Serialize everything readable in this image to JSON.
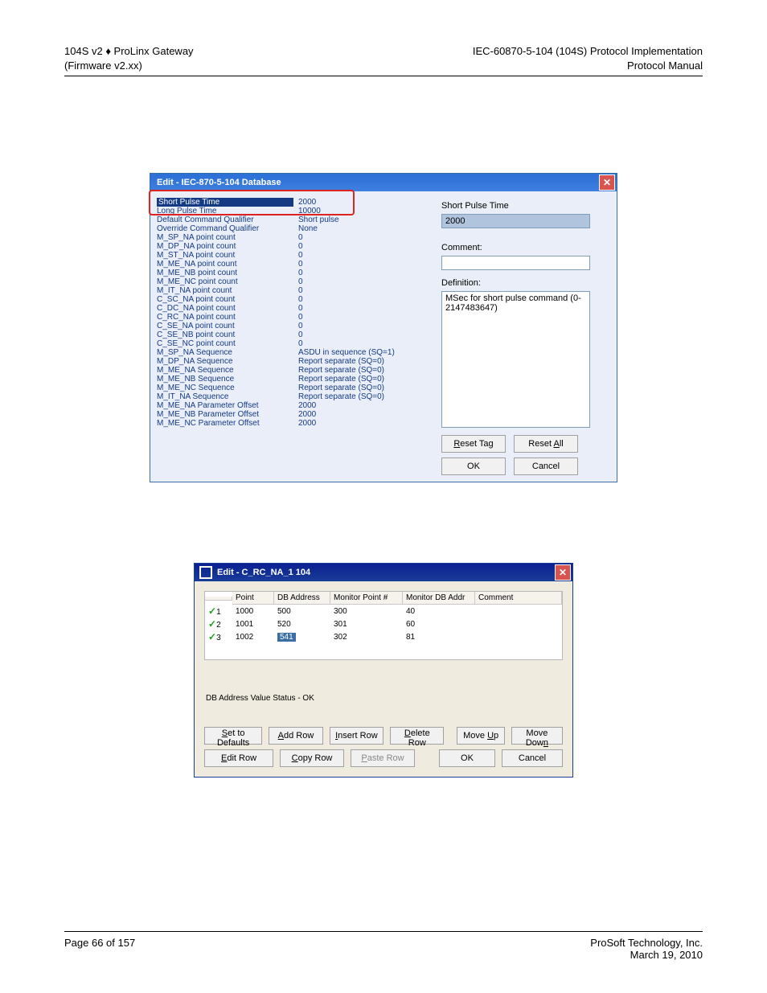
{
  "header": {
    "left1": "104S v2 ♦ ProLinx Gateway",
    "left2": "(Firmware v2.xx)",
    "right1": "IEC-60870-5-104 (104S) Protocol Implementation",
    "right2": "Protocol Manual"
  },
  "dialog1": {
    "title": "Edit - IEC-870-5-104 Database",
    "rows": [
      {
        "name": "Short Pulse Time",
        "val": "2000",
        "selected": true
      },
      {
        "name": "Long Pulse Time",
        "val": "10000"
      },
      {
        "name": "Default Command Qualifier",
        "val": "Short pulse"
      },
      {
        "name": "Override Command Qualifier",
        "val": "None"
      },
      {
        "name": "M_SP_NA point count",
        "val": "0"
      },
      {
        "name": "M_DP_NA point count",
        "val": "0"
      },
      {
        "name": "M_ST_NA point count",
        "val": "0"
      },
      {
        "name": "M_ME_NA point count",
        "val": "0"
      },
      {
        "name": "M_ME_NB point count",
        "val": "0"
      },
      {
        "name": "M_ME_NC point count",
        "val": "0"
      },
      {
        "name": "M_IT_NA point count",
        "val": "0"
      },
      {
        "name": "C_SC_NA point count",
        "val": "0"
      },
      {
        "name": "C_DC_NA point count",
        "val": "0"
      },
      {
        "name": "C_RC_NA point count",
        "val": "0"
      },
      {
        "name": "C_SE_NA point count",
        "val": "0"
      },
      {
        "name": "C_SE_NB point count",
        "val": "0"
      },
      {
        "name": "C_SE_NC point count",
        "val": "0"
      },
      {
        "name": "M_SP_NA Sequence",
        "val": "ASDU in sequence (SQ=1)"
      },
      {
        "name": "M_DP_NA Sequence",
        "val": "Report separate (SQ=0)"
      },
      {
        "name": "M_ME_NA Sequence",
        "val": "Report separate (SQ=0)"
      },
      {
        "name": "M_ME_NB Sequence",
        "val": "Report separate (SQ=0)"
      },
      {
        "name": "M_ME_NC Sequence",
        "val": "Report separate (SQ=0)"
      },
      {
        "name": "M_IT_NA Sequence",
        "val": "Report separate (SQ=0)"
      },
      {
        "name": "M_ME_NA Parameter Offset",
        "val": "2000"
      },
      {
        "name": "M_ME_NB Parameter Offset",
        "val": "2000"
      },
      {
        "name": "M_ME_NC Parameter Offset",
        "val": "2000"
      }
    ],
    "right": {
      "field_label": "Short Pulse Time",
      "field_value": "2000",
      "comment_label": "Comment:",
      "comment_value": "",
      "definition_label": "Definition:",
      "definition_value": "MSec for short pulse command (0-2147483647)",
      "reset_tag": "Reset Tag",
      "reset_all": "Reset All",
      "ok": "OK",
      "cancel": "Cancel"
    }
  },
  "dialog2": {
    "title": "Edit - C_RC_NA_1 104",
    "headers": [
      "",
      "Point",
      "DB Address",
      "Monitor Point #",
      "Monitor DB Addr",
      "Comment"
    ],
    "rows": [
      {
        "idx": "1",
        "point": "1000",
        "db": "500",
        "mp": "300",
        "mdb": "40",
        "c": ""
      },
      {
        "idx": "2",
        "point": "1001",
        "db": "520",
        "mp": "301",
        "mdb": "60",
        "c": ""
      },
      {
        "idx": "3",
        "point": "1002",
        "db": "541",
        "mp": "302",
        "mdb": "81",
        "c": "",
        "dbsel": true
      }
    ],
    "status": "DB Address Value Status - OK",
    "buttons": {
      "set_defaults": "Set to Defaults",
      "add_row": "Add Row",
      "insert_row": "Insert Row",
      "delete_row": "Delete Row",
      "move_up": "Move Up",
      "move_down": "Move Down",
      "edit_row": "Edit Row",
      "copy_row": "Copy Row",
      "paste_row": "Paste Row",
      "ok": "OK",
      "cancel": "Cancel"
    }
  },
  "footer": {
    "left": "Page 66 of 157",
    "right1": "ProSoft Technology, Inc.",
    "right2": "March 19, 2010"
  }
}
